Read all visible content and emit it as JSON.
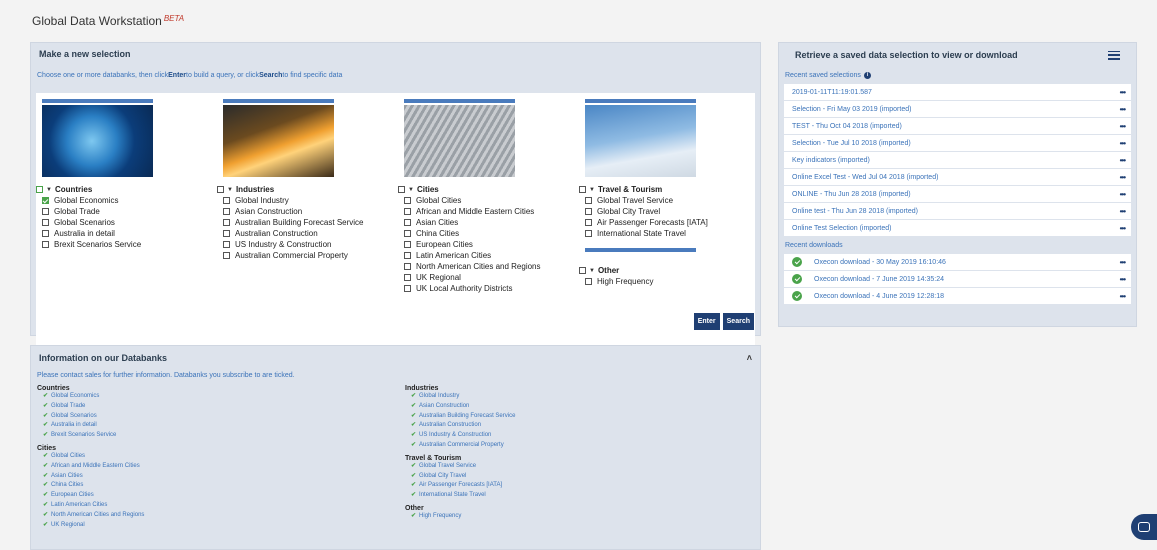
{
  "app": {
    "title": "Global Data Workstation",
    "beta": "BETA"
  },
  "selection": {
    "header": "Make a new selection",
    "hint_prefix": "Choose one or more databanks, then click ",
    "hint_enter": "Enter",
    "hint_middle": " to build a query, or click ",
    "hint_search": "Search",
    "hint_suffix": " to find specific data",
    "columns": [
      {
        "heading": "Countries",
        "items": [
          "Global Economics",
          "Global Trade",
          "Global Scenarios",
          "Australia in detail",
          "Brexit Scenarios Service"
        ]
      },
      {
        "heading": "Industries",
        "items": [
          "Global Industry",
          "Asian Construction",
          "Australian Building Forecast Service",
          "Australian Construction",
          "US Industry & Construction",
          "Australian Commercial Property"
        ]
      },
      {
        "heading": "Cities",
        "items": [
          "Global Cities",
          "African and Middle Eastern Cities",
          "Asian Cities",
          "China Cities",
          "European Cities",
          "Latin American Cities",
          "North American Cities and Regions",
          "UK Regional",
          "UK Local Authority Districts"
        ]
      },
      {
        "heading": "Travel & Tourism",
        "items": [
          "Global Travel Service",
          "Global City Travel",
          "Air Passenger Forecasts [IATA]",
          "International State Travel"
        ]
      }
    ],
    "other": {
      "heading": "Other",
      "items": [
        "High Frequency"
      ]
    },
    "enter_label": "Enter",
    "search_label": "Search"
  },
  "info": {
    "header": "Information on our Databanks",
    "hint": "Please contact sales for further information. Databanks you subscribe to are ticked.",
    "left_groups": [
      {
        "name": "Countries",
        "items": [
          "Global Economics",
          "Global Trade",
          "Global Scenarios",
          "Australia in detail",
          "Brexit Scenarios Service"
        ]
      },
      {
        "name": "Cities",
        "items": [
          "Global Cities",
          "African and Middle Eastern Cities",
          "Asian Cities",
          "China Cities",
          "European Cities",
          "Latin American Cities",
          "North American Cities and Regions",
          "UK Regional"
        ]
      }
    ],
    "right_groups": [
      {
        "name": "Industries",
        "items": [
          "Global Industry",
          "Asian Construction",
          "Australian Building Forecast Service",
          "Australian Construction",
          "US Industry & Construction",
          "Australian Commercial Property"
        ]
      },
      {
        "name": "Travel & Tourism",
        "items": [
          "Global Travel Service",
          "Global City Travel",
          "Air Passenger Forecasts [IATA]",
          "International State Travel"
        ]
      },
      {
        "name": "Other",
        "items": [
          "High Frequency"
        ]
      }
    ]
  },
  "saved": {
    "header": "Retrieve a saved data selection to view or download",
    "recent_label": "Recent saved selections",
    "selections": [
      "2019-01-11T11:19:01.587",
      "Selection - Fri May 03 2019 (imported)",
      "TEST - Thu Oct 04 2018 (imported)",
      "Selection - Tue Jul 10 2018 (imported)",
      "Key indicators (imported)",
      "Online Excel Test - Wed Jul 04 2018 (imported)",
      "ONLINE - Thu Jun 28 2018 (imported)",
      "Online test - Thu Jun 28 2018 (imported)",
      "Online Test Selection (imported)"
    ],
    "downloads_label": "Recent downloads",
    "downloads": [
      "Oxecon download - 30 May 2019 16:10:46",
      "Oxecon download - 7 June 2019 14:35:24",
      "Oxecon download - 4 June 2019 12:28:18"
    ],
    "more": "•••"
  },
  "colors": {
    "accent": "#1f3f73",
    "link": "#3b73b9",
    "tick": "#4aa34a",
    "panel": "#dde3ec"
  }
}
